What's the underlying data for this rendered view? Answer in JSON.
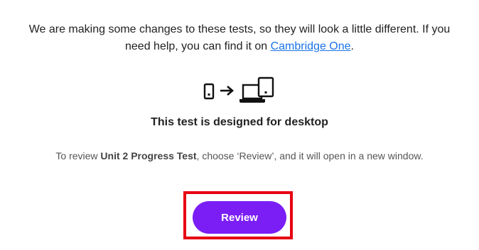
{
  "notice": {
    "text_line1": "We are making some changes to these tests, so they will look a little different. If you",
    "text_line2_prefix": "need help, you can find it on ",
    "link_label": "Cambridge One",
    "text_line2_suffix": "."
  },
  "device_graphic": {
    "icons": [
      "mobile-phone-icon",
      "arrow-right-icon",
      "laptop-icon",
      "tablet-icon"
    ]
  },
  "headline": "This test is designed for desktop",
  "instructions": {
    "prefix": "To review ",
    "test_name": "Unit 2 Progress Test",
    "suffix": ", choose ‘Review’, and it will open in a new window."
  },
  "review_button": {
    "label": "Review",
    "color": "#7a1ef5"
  },
  "highlight_color": "#e60012"
}
